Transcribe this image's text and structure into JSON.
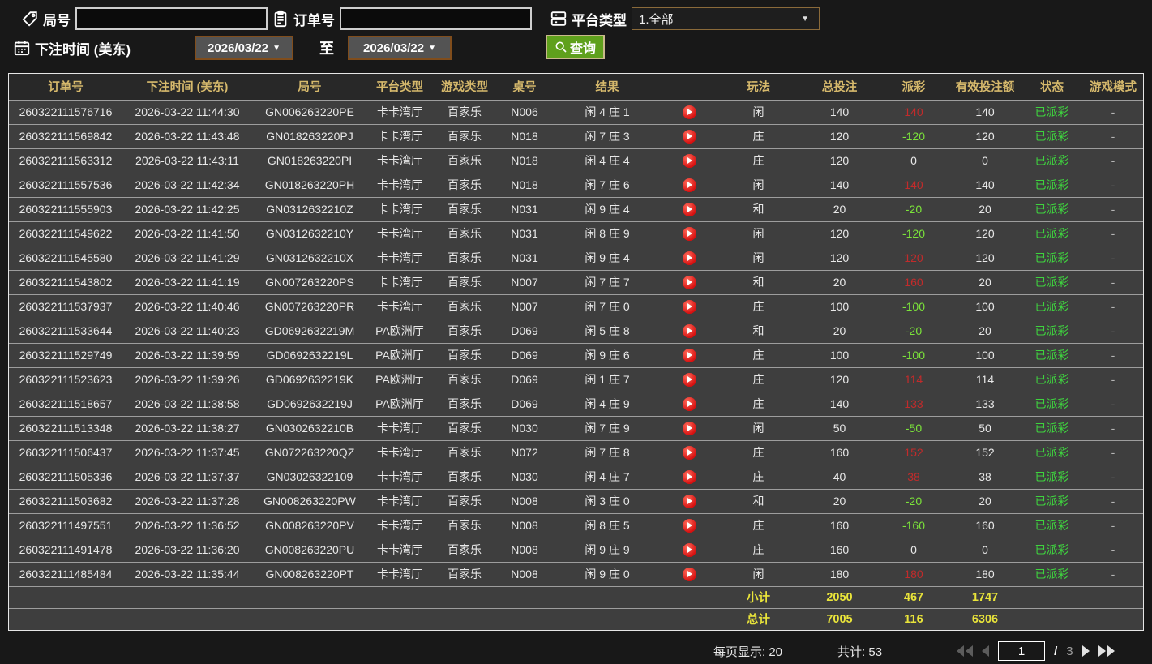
{
  "filters": {
    "game_no": {
      "label": "局号",
      "value": ""
    },
    "order_no": {
      "label": "订单号",
      "value": ""
    },
    "platform_type": {
      "label": "平台类型",
      "value": "1.全部"
    },
    "bet_time": {
      "label": "下注时间 (美东)",
      "from": "2026/03/22",
      "to_separator": "至",
      "to": "2026/03/22"
    },
    "query_button": "查询"
  },
  "table": {
    "headers": [
      "订单号",
      "下注时间 (美东)",
      "局号",
      "平台类型",
      "游戏类型",
      "桌号",
      "结果",
      "",
      "玩法",
      "总投注",
      "派彩",
      "有效投注额",
      "状态",
      "游戏模式"
    ],
    "rows": [
      {
        "order_id": "260322111576716",
        "bet_time": "2026-03-22 11:44:30",
        "game_no": "GN006263220PE",
        "platform": "卡卡湾厅",
        "game_type": "百家乐",
        "table_no": "N006",
        "result": "闲 4 庄 1",
        "play": "闲",
        "total_bet": "140",
        "payout": "140",
        "valid_bet": "140",
        "status": "已派彩",
        "game_mode": "-"
      },
      {
        "order_id": "260322111569842",
        "bet_time": "2026-03-22 11:43:48",
        "game_no": "GN018263220PJ",
        "platform": "卡卡湾厅",
        "game_type": "百家乐",
        "table_no": "N018",
        "result": "闲 7 庄 3",
        "play": "庄",
        "total_bet": "120",
        "payout": "-120",
        "valid_bet": "120",
        "status": "已派彩",
        "game_mode": "-"
      },
      {
        "order_id": "260322111563312",
        "bet_time": "2026-03-22 11:43:11",
        "game_no": "GN018263220PI",
        "platform": "卡卡湾厅",
        "game_type": "百家乐",
        "table_no": "N018",
        "result": "闲 4 庄 4",
        "play": "庄",
        "total_bet": "120",
        "payout": "0",
        "valid_bet": "0",
        "status": "已派彩",
        "game_mode": "-"
      },
      {
        "order_id": "260322111557536",
        "bet_time": "2026-03-22 11:42:34",
        "game_no": "GN018263220PH",
        "platform": "卡卡湾厅",
        "game_type": "百家乐",
        "table_no": "N018",
        "result": "闲 7 庄 6",
        "play": "闲",
        "total_bet": "140",
        "payout": "140",
        "valid_bet": "140",
        "status": "已派彩",
        "game_mode": "-"
      },
      {
        "order_id": "260322111555903",
        "bet_time": "2026-03-22 11:42:25",
        "game_no": "GN0312632210Z",
        "platform": "卡卡湾厅",
        "game_type": "百家乐",
        "table_no": "N031",
        "result": "闲 9 庄 4",
        "play": "和",
        "total_bet": "20",
        "payout": "-20",
        "valid_bet": "20",
        "status": "已派彩",
        "game_mode": "-"
      },
      {
        "order_id": "260322111549622",
        "bet_time": "2026-03-22 11:41:50",
        "game_no": "GN0312632210Y",
        "platform": "卡卡湾厅",
        "game_type": "百家乐",
        "table_no": "N031",
        "result": "闲 8 庄 9",
        "play": "闲",
        "total_bet": "120",
        "payout": "-120",
        "valid_bet": "120",
        "status": "已派彩",
        "game_mode": "-"
      },
      {
        "order_id": "260322111545580",
        "bet_time": "2026-03-22 11:41:29",
        "game_no": "GN0312632210X",
        "platform": "卡卡湾厅",
        "game_type": "百家乐",
        "table_no": "N031",
        "result": "闲 9 庄 4",
        "play": "闲",
        "total_bet": "120",
        "payout": "120",
        "valid_bet": "120",
        "status": "已派彩",
        "game_mode": "-"
      },
      {
        "order_id": "260322111543802",
        "bet_time": "2026-03-22 11:41:19",
        "game_no": "GN007263220PS",
        "platform": "卡卡湾厅",
        "game_type": "百家乐",
        "table_no": "N007",
        "result": "闲 7 庄 7",
        "play": "和",
        "total_bet": "20",
        "payout": "160",
        "valid_bet": "20",
        "status": "已派彩",
        "game_mode": "-"
      },
      {
        "order_id": "260322111537937",
        "bet_time": "2026-03-22 11:40:46",
        "game_no": "GN007263220PR",
        "platform": "卡卡湾厅",
        "game_type": "百家乐",
        "table_no": "N007",
        "result": "闲 7 庄 0",
        "play": "庄",
        "total_bet": "100",
        "payout": "-100",
        "valid_bet": "100",
        "status": "已派彩",
        "game_mode": "-"
      },
      {
        "order_id": "260322111533644",
        "bet_time": "2026-03-22 11:40:23",
        "game_no": "GD0692632219M",
        "platform": "PA欧洲厅",
        "game_type": "百家乐",
        "table_no": "D069",
        "result": "闲 5 庄 8",
        "play": "和",
        "total_bet": "20",
        "payout": "-20",
        "valid_bet": "20",
        "status": "已派彩",
        "game_mode": "-"
      },
      {
        "order_id": "260322111529749",
        "bet_time": "2026-03-22 11:39:59",
        "game_no": "GD0692632219L",
        "platform": "PA欧洲厅",
        "game_type": "百家乐",
        "table_no": "D069",
        "result": "闲 9 庄 6",
        "play": "庄",
        "total_bet": "100",
        "payout": "-100",
        "valid_bet": "100",
        "status": "已派彩",
        "game_mode": "-"
      },
      {
        "order_id": "260322111523623",
        "bet_time": "2026-03-22 11:39:26",
        "game_no": "GD0692632219K",
        "platform": "PA欧洲厅",
        "game_type": "百家乐",
        "table_no": "D069",
        "result": "闲 1 庄 7",
        "play": "庄",
        "total_bet": "120",
        "payout": "114",
        "valid_bet": "114",
        "status": "已派彩",
        "game_mode": "-"
      },
      {
        "order_id": "260322111518657",
        "bet_time": "2026-03-22 11:38:58",
        "game_no": "GD0692632219J",
        "platform": "PA欧洲厅",
        "game_type": "百家乐",
        "table_no": "D069",
        "result": "闲 4 庄 9",
        "play": "庄",
        "total_bet": "140",
        "payout": "133",
        "valid_bet": "133",
        "status": "已派彩",
        "game_mode": "-"
      },
      {
        "order_id": "260322111513348",
        "bet_time": "2026-03-22 11:38:27",
        "game_no": "GN0302632210B",
        "platform": "卡卡湾厅",
        "game_type": "百家乐",
        "table_no": "N030",
        "result": "闲 7 庄 9",
        "play": "闲",
        "total_bet": "50",
        "payout": "-50",
        "valid_bet": "50",
        "status": "已派彩",
        "game_mode": "-"
      },
      {
        "order_id": "260322111506437",
        "bet_time": "2026-03-22 11:37:45",
        "game_no": "GN072263220QZ",
        "platform": "卡卡湾厅",
        "game_type": "百家乐",
        "table_no": "N072",
        "result": "闲 7 庄 8",
        "play": "庄",
        "total_bet": "160",
        "payout": "152",
        "valid_bet": "152",
        "status": "已派彩",
        "game_mode": "-"
      },
      {
        "order_id": "260322111505336",
        "bet_time": "2026-03-22 11:37:37",
        "game_no": "GN03026322109",
        "platform": "卡卡湾厅",
        "game_type": "百家乐",
        "table_no": "N030",
        "result": "闲 4 庄 7",
        "play": "庄",
        "total_bet": "40",
        "payout": "38",
        "valid_bet": "38",
        "status": "已派彩",
        "game_mode": "-"
      },
      {
        "order_id": "260322111503682",
        "bet_time": "2026-03-22 11:37:28",
        "game_no": "GN008263220PW",
        "platform": "卡卡湾厅",
        "game_type": "百家乐",
        "table_no": "N008",
        "result": "闲 3 庄 0",
        "play": "和",
        "total_bet": "20",
        "payout": "-20",
        "valid_bet": "20",
        "status": "已派彩",
        "game_mode": "-"
      },
      {
        "order_id": "260322111497551",
        "bet_time": "2026-03-22 11:36:52",
        "game_no": "GN008263220PV",
        "platform": "卡卡湾厅",
        "game_type": "百家乐",
        "table_no": "N008",
        "result": "闲 8 庄 5",
        "play": "庄",
        "total_bet": "160",
        "payout": "-160",
        "valid_bet": "160",
        "status": "已派彩",
        "game_mode": "-"
      },
      {
        "order_id": "260322111491478",
        "bet_time": "2026-03-22 11:36:20",
        "game_no": "GN008263220PU",
        "platform": "卡卡湾厅",
        "game_type": "百家乐",
        "table_no": "N008",
        "result": "闲 9 庄 9",
        "play": "庄",
        "total_bet": "160",
        "payout": "0",
        "valid_bet": "0",
        "status": "已派彩",
        "game_mode": "-"
      },
      {
        "order_id": "260322111485484",
        "bet_time": "2026-03-22 11:35:44",
        "game_no": "GN008263220PT",
        "platform": "卡卡湾厅",
        "game_type": "百家乐",
        "table_no": "N008",
        "result": "闲 9 庄 0",
        "play": "闲",
        "total_bet": "180",
        "payout": "180",
        "valid_bet": "180",
        "status": "已派彩",
        "game_mode": "-"
      }
    ],
    "subtotal": {
      "label": "小计",
      "total_bet": "2050",
      "payout": "467",
      "valid_bet": "1747"
    },
    "grand_total": {
      "label": "总计",
      "total_bet": "7005",
      "payout": "116",
      "valid_bet": "6306"
    }
  },
  "pagination": {
    "per_page_label": "每页显示:",
    "per_page_value": "20",
    "total_label": "共计:",
    "total_value": "53",
    "current_page": "1",
    "separator": "/",
    "total_pages": "3"
  },
  "colors": {
    "header_text": "#d6b96c",
    "payout_positive": "#c22b2b",
    "payout_negative": "#7be33a",
    "status_paid": "#3ed43e",
    "totals_yellow": "#e9e43a",
    "query_button_green": "#5fa01c"
  }
}
